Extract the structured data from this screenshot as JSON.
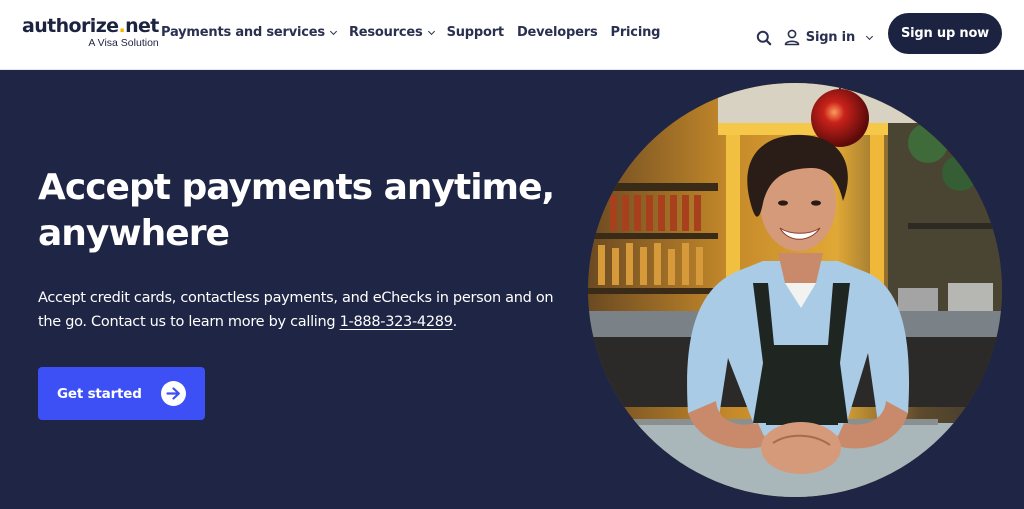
{
  "brand": {
    "name_prefix": "authorize",
    "name_dot": ".",
    "name_suffix": "net",
    "tagline": "A Visa Solution"
  },
  "nav": {
    "items": [
      {
        "label": "Payments and services",
        "has_dropdown": true
      },
      {
        "label": "Resources",
        "has_dropdown": true
      },
      {
        "label": "Support",
        "has_dropdown": false
      },
      {
        "label": "Developers",
        "has_dropdown": false
      },
      {
        "label": "Pricing",
        "has_dropdown": false
      }
    ]
  },
  "header_tools": {
    "search_icon": "search-icon",
    "user_icon": "user-icon",
    "signin_label": "Sign in",
    "signup_label": "Sign up now"
  },
  "hero": {
    "title": "Accept payments anytime, anywhere",
    "description_prefix": "Accept credit cards, contactless payments, and eChecks in person and on the go. Contact us to learn more by calling ",
    "phone": "1-888-323-4289",
    "description_suffix": ".",
    "cta_label": "Get started",
    "cta_icon": "arrow-right-circle-icon",
    "image_alt": "Smiling bartender leaning on bar counter"
  },
  "colors": {
    "hero_bg": "#1f2544",
    "brand_navy": "#1c2340",
    "cta_blue": "#3d50f5",
    "logo_dot": "#f5b400"
  }
}
